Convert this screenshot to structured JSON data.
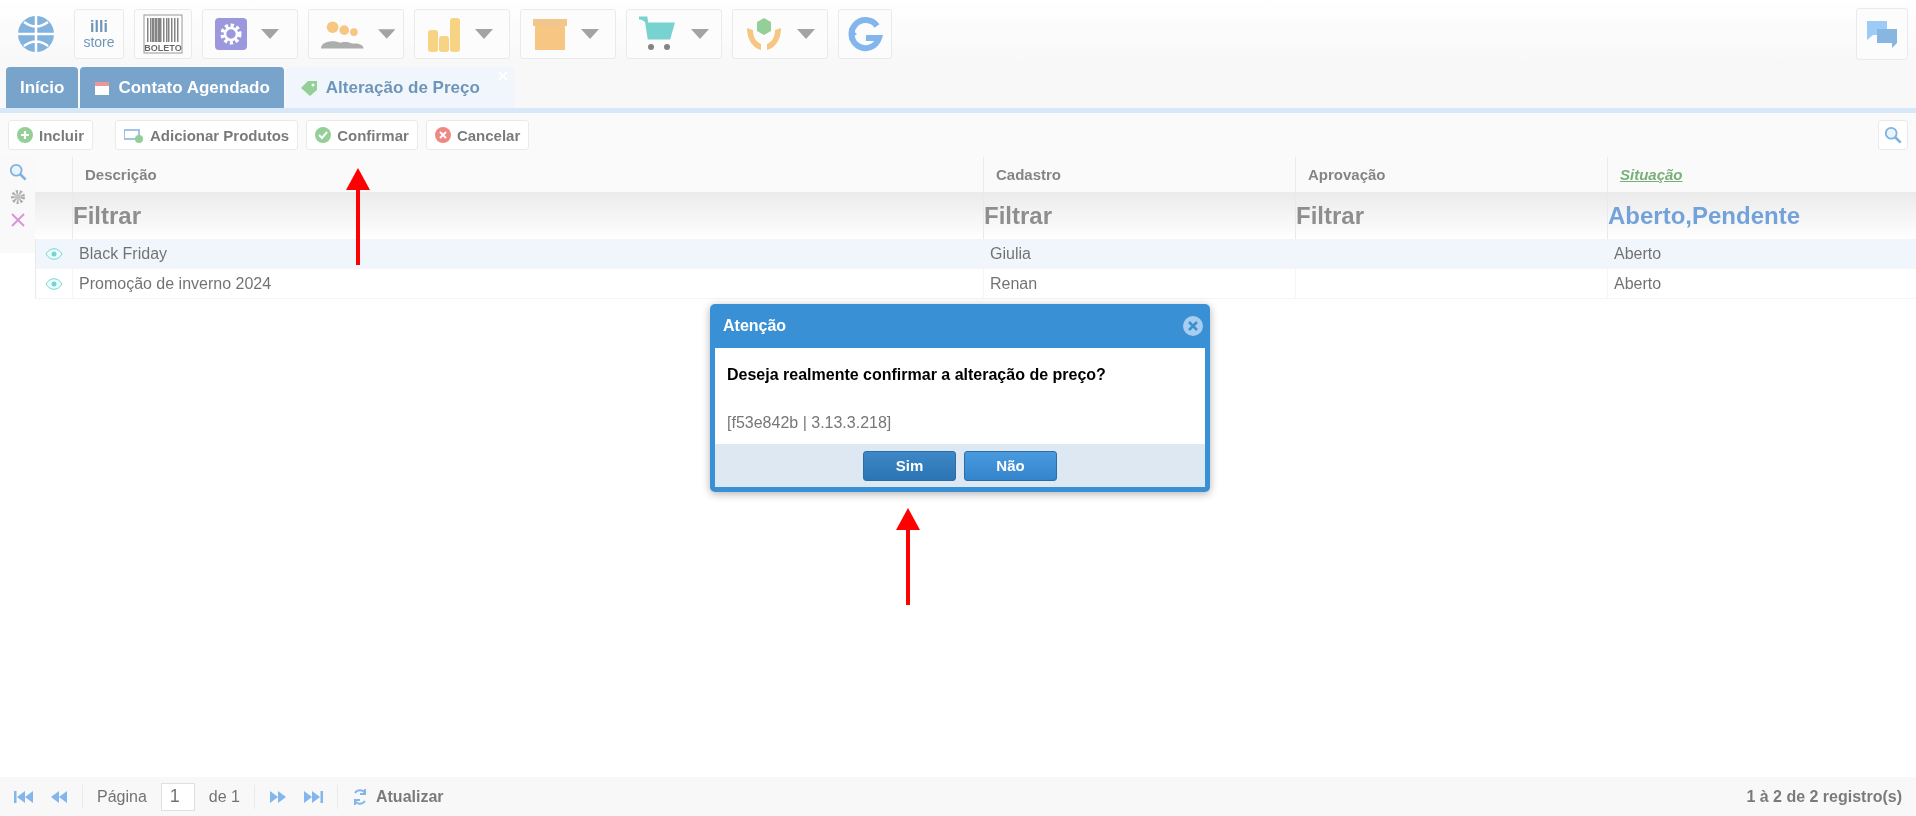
{
  "top_toolbar": {
    "items": [
      {
        "kind": "logo",
        "dropdown": false
      },
      {
        "kind": "store",
        "label": "illi",
        "sublabel": "store",
        "dropdown": false
      },
      {
        "kind": "barcode",
        "label": "BOLETO",
        "dropdown": false
      },
      {
        "kind": "settings",
        "dropdown": true
      },
      {
        "kind": "people",
        "dropdown": true
      },
      {
        "kind": "coins",
        "dropdown": true
      },
      {
        "kind": "box",
        "dropdown": true
      },
      {
        "kind": "cart",
        "dropdown": true
      },
      {
        "kind": "hands",
        "dropdown": true
      },
      {
        "kind": "sync",
        "dropdown": false
      }
    ]
  },
  "tabs": [
    {
      "label": "Início",
      "kind": "plain",
      "selected": false,
      "closable": false
    },
    {
      "label": "Contato Agendado",
      "kind": "calendar",
      "selected": false,
      "closable": false
    },
    {
      "label": "Alteração de Preço",
      "kind": "tag",
      "selected": true,
      "closable": true
    }
  ],
  "actions": [
    {
      "label": "Incluir",
      "kind": "add"
    },
    {
      "label": "Adicionar Produtos",
      "kind": "add-products"
    },
    {
      "label": "Confirmar",
      "kind": "confirm"
    },
    {
      "label": "Cancelar",
      "kind": "cancel"
    }
  ],
  "table": {
    "columns": [
      {
        "label": "Descrição",
        "sorted": false
      },
      {
        "label": "Cadastro",
        "sorted": false
      },
      {
        "label": "Aprovação",
        "sorted": false
      },
      {
        "label": "Situação",
        "sorted": true
      }
    ],
    "filters": [
      {
        "placeholder": "Filtrar"
      },
      {
        "placeholder": "Filtrar"
      },
      {
        "placeholder": "Filtrar"
      },
      {
        "value": "Aberto,Pendente"
      }
    ],
    "rows": [
      {
        "cells": [
          "Black Friday",
          "Giulia",
          "",
          "Aberto"
        ]
      },
      {
        "cells": [
          "Promoção de inverno 2024",
          "Renan",
          "",
          "Aberto"
        ]
      }
    ]
  },
  "pager": {
    "page_label": "Página",
    "page": "1",
    "of": "de 1",
    "refresh": "Atualizar",
    "summary": "1 à 2 de 2 registro(s)"
  },
  "dialog": {
    "title": "Atenção",
    "message": "Deseja realmente confirmar a alteração de preço?",
    "code": "[f53e842b | 3.13.3.218]",
    "buttons": [
      {
        "label": "Sim",
        "selected": true
      },
      {
        "label": "Não",
        "selected": false
      }
    ]
  }
}
